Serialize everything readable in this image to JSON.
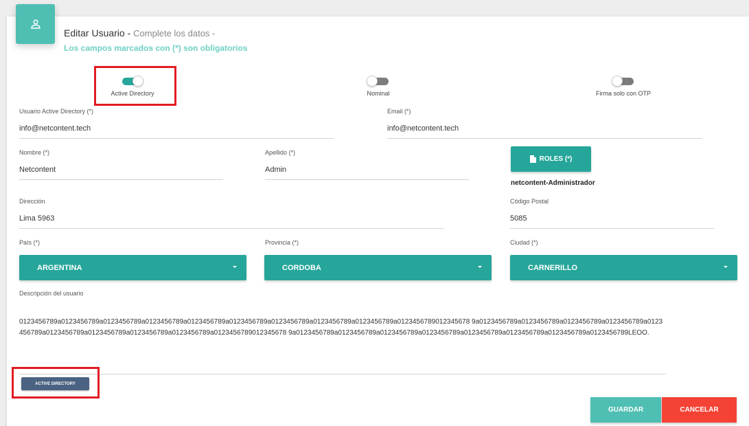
{
  "header": {
    "title": "Editar Usuario",
    "title_separator": " - ",
    "subtitle": "Complete los datos -",
    "required_note": "Los campos marcados con (*) son obligatorios",
    "icon": "user-icon"
  },
  "toggles": [
    {
      "label": "Active Directory",
      "checked": true
    },
    {
      "label": "Nominal",
      "checked": false
    },
    {
      "label": "Firma solo con OTP",
      "checked": false
    }
  ],
  "fields": {
    "ad_user": {
      "label": "Usuario Active Directory (*)",
      "value": "info@netcontent.tech"
    },
    "email": {
      "label": "Email (*)",
      "value": "info@netcontent.tech"
    },
    "nombre": {
      "label": "Nombre (*)",
      "value": "Netcontent"
    },
    "apellido": {
      "label": "Apellido (*)",
      "value": "Admin"
    },
    "direccion": {
      "label": "Dirección",
      "value": "Lima 5963"
    },
    "codigo_postal": {
      "label": "Código Postal",
      "value": "5085"
    },
    "descripcion": {
      "label": "Descripción del usuario",
      "value": "0123456789a0123456789a0123456789a0123456789a0123456789a0123456789a0123456789a0123456789a0123456789a0123456789012345678 9a0123456789a0123456789a0123456789a0123456789a0123456789a0123456789a0123456789a0123456789a0123456789a0123456789012345678 9a0123456789a0123456789a0123456789a0123456789a0123456789a0123456789a0123456789a0123456789LEOO."
    }
  },
  "roles": {
    "button_label": "ROLES (*)",
    "icon": "file-icon",
    "assigned": "netcontent-Administrador"
  },
  "selects": {
    "pais": {
      "label": "País (*)",
      "value": "ARGENTINA"
    },
    "provincia": {
      "label": "Provincia (*)",
      "value": "CORDOBA"
    },
    "ciudad": {
      "label": "Ciudad (*)",
      "value": "CARNERILLO"
    }
  },
  "buttons": {
    "active_directory": "ACTIVE DIRECTORY",
    "save": "GUARDAR",
    "cancel": "CANCELAR"
  },
  "colors": {
    "primary": "#26a69a",
    "accent_light": "#4fbfb3",
    "danger": "#f44336",
    "ad_button": "#4b6382",
    "highlight": "#e11d24"
  }
}
